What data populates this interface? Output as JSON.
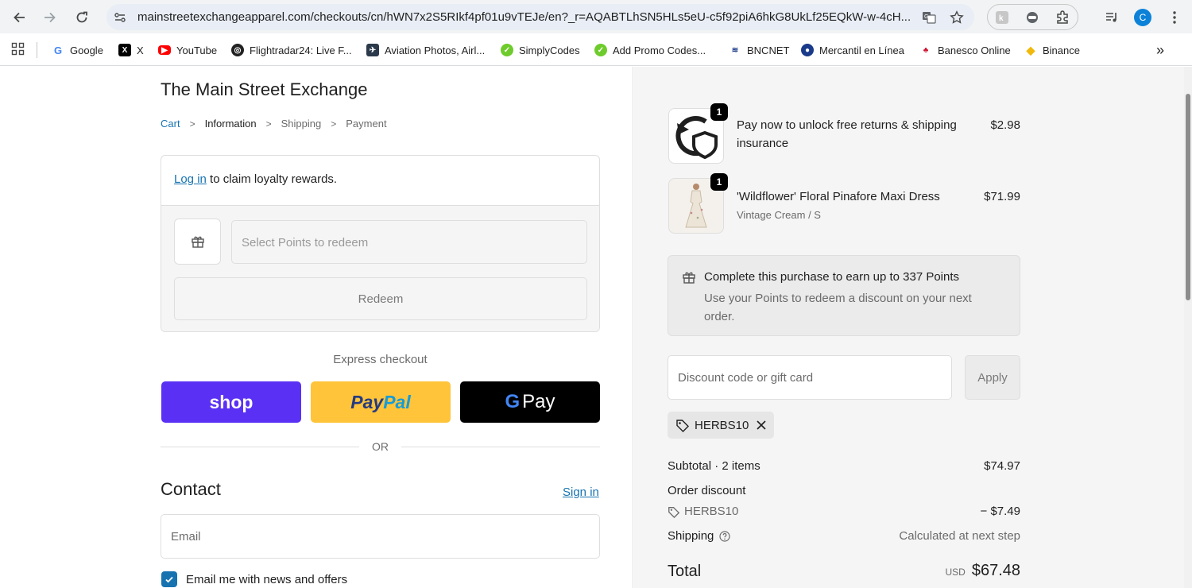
{
  "browser": {
    "url": "mainstreetexchangeapparel.com/checkouts/cn/hWN7x2S5RIkf4pf01u9vTEJe/en?_r=AQABTLhSN5HLs5eU-c5f92piA6hkG8UkLf25EQkW-w-4cH...",
    "profile_initial": "C",
    "bookmarks": [
      {
        "label": "Google"
      },
      {
        "label": "X"
      },
      {
        "label": "YouTube"
      },
      {
        "label": "Flightradar24: Live F..."
      },
      {
        "label": "Aviation Photos, Airl..."
      },
      {
        "label": "SimplyCodes"
      },
      {
        "label": "Add Promo Codes..."
      },
      {
        "label": "BNCNET"
      },
      {
        "label": "Mercantil en Línea"
      },
      {
        "label": "Banesco Online"
      },
      {
        "label": "Binance"
      }
    ],
    "more_bookmarks": "»"
  },
  "store": {
    "title": "The Main Street Exchange"
  },
  "breadcrumb": {
    "cart": "Cart",
    "information": "Information",
    "shipping": "Shipping",
    "payment": "Payment",
    "separator": ">"
  },
  "loyalty": {
    "login_link": "Log in",
    "login_text": " to claim loyalty rewards.",
    "points_placeholder": "Select Points to redeem",
    "redeem_label": "Redeem"
  },
  "express": {
    "label": "Express checkout",
    "shop_label": "shop",
    "paypal_label_a": "Pay",
    "paypal_label_b": "Pal",
    "gpay_label": "Pay",
    "or_label": "OR"
  },
  "contact": {
    "heading": "Contact",
    "signin_label": "Sign in",
    "email_placeholder": "Email",
    "newsletter_label": "Email me with news and offers",
    "newsletter_checked": true
  },
  "order": {
    "items": [
      {
        "title": "Pay now to unlock free returns & shipping insurance",
        "variant": "",
        "price": "$2.98",
        "qty": "1",
        "image": "return-shield-icon"
      },
      {
        "title": "'Wildflower' Floral Pinafore Maxi Dress",
        "variant": "Vintage Cream / S",
        "price": "$71.99",
        "qty": "1",
        "image": "dress-photo"
      }
    ],
    "earn_title": "Complete this purchase to earn up to 337 Points",
    "earn_subtitle": "Use your Points to redeem a discount on your next order.",
    "discount_placeholder": "Discount code or gift card",
    "apply_label": "Apply",
    "applied_code": "HERBS10",
    "subtotal_label": "Subtotal · 2 items",
    "subtotal_value": "$74.97",
    "order_discount_label": "Order discount",
    "discount_code": "HERBS10",
    "discount_value": "− $7.49",
    "shipping_label": "Shipping",
    "shipping_value": "Calculated at next step",
    "total_label": "Total",
    "currency": "USD",
    "total_value": "$67.48"
  },
  "colors": {
    "shop": "#5a31f4",
    "paypal": "#ffc439",
    "gpay": "#000000",
    "link": "#1773b0"
  }
}
